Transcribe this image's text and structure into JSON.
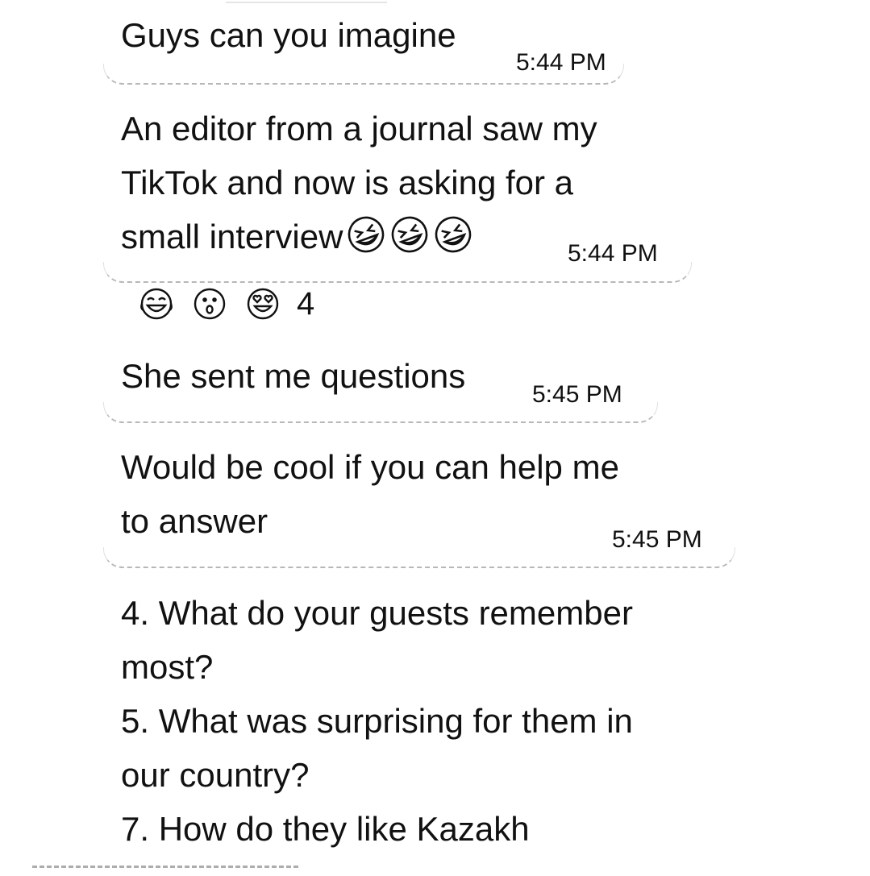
{
  "messages": [
    {
      "text": "Guys can you imagine",
      "time": "5:44 PM"
    },
    {
      "text": "An editor from a journal saw my\nTikTok and now is asking for a\nsmall interview",
      "time": "5:44 PM",
      "trailing_emojis": [
        "rolling-on-floor-laughing-emoji",
        "rolling-on-floor-laughing-emoji",
        "rolling-on-floor-laughing-emoji"
      ]
    },
    {
      "text": "She sent me questions",
      "time": "5:45 PM"
    },
    {
      "text": "Would be cool if you can help me\nto answer",
      "time": "5:45 PM"
    },
    {
      "text": "4. What do your guests remember\nmost?\n5. What was surprising for them in\nour country?\n7. How do they like Kazakh"
    }
  ],
  "reactions": {
    "emojis": [
      "tears-of-joy-emoji",
      "astonished-face-emoji",
      "heart-eyes-emoji"
    ],
    "count": "4"
  }
}
